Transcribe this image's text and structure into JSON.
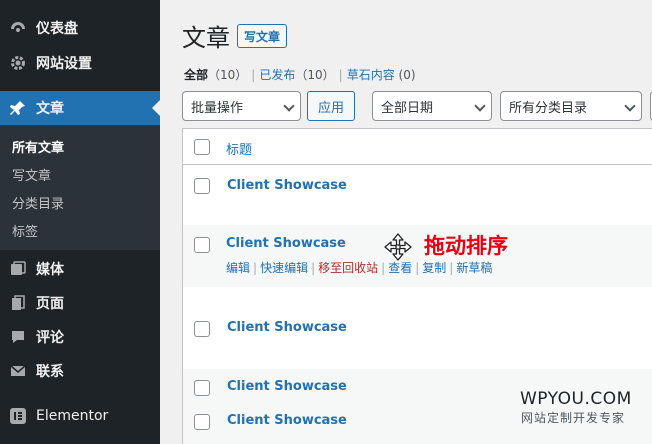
{
  "sidebar": {
    "items": [
      {
        "label": "仪表盘",
        "icon": "dashboard-icon"
      },
      {
        "label": "网站设置",
        "icon": "gear-icon"
      },
      {
        "label": "文章",
        "icon": "pin-icon"
      },
      {
        "label": "媒体",
        "icon": "media-icon"
      },
      {
        "label": "页面",
        "icon": "pages-icon"
      },
      {
        "label": "评论",
        "icon": "comment-icon"
      },
      {
        "label": "联系",
        "icon": "mail-icon"
      },
      {
        "label": "Elementor",
        "icon": "elementor-icon"
      }
    ],
    "submenu": [
      "所有文章",
      "写文章",
      "分类目录",
      "标签"
    ],
    "active_item": "文章",
    "current_sub": "所有文章"
  },
  "header": {
    "title": "文章",
    "add_new": "写文章"
  },
  "filters": {
    "all": "全部",
    "all_count": "（10）",
    "published": "已发布",
    "published_count": "（10）",
    "drafts": "草石内容",
    "drafts_count": "(0)"
  },
  "toolbar": {
    "bulk_action": "批量操作",
    "apply": "应用",
    "date_filter": "全部日期",
    "category_filter": "所有分类目录"
  },
  "table": {
    "header_title": "标题",
    "rows": [
      {
        "title": "Client Showcase"
      },
      {
        "title": "Client Showcase"
      },
      {
        "title": "Client Showcase"
      },
      {
        "title": "Client Showcase"
      },
      {
        "title": "Client Showcase"
      }
    ],
    "row_actions": [
      "编辑",
      "快速编辑",
      "移至回收站",
      "查看",
      "复制",
      "新草稿"
    ]
  },
  "overlay": {
    "drag_label": "拖动排序",
    "drag_icon": "move-icon"
  },
  "watermark": {
    "brand": "WPYOU.COM",
    "tagline": "网站定制开发专家"
  },
  "colors": {
    "sidebar_bg": "#1d2327",
    "accent": "#2271b1",
    "trash": "#b32d2e",
    "annotation": "#e60012"
  }
}
